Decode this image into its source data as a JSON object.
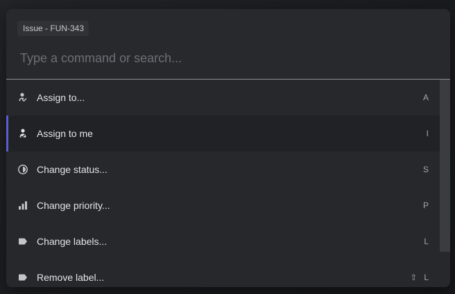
{
  "palette": {
    "context_chip": "Issue - FUN-343",
    "search": {
      "placeholder": "Type a command or search...",
      "value": ""
    },
    "commands": [
      {
        "label": "Assign to...",
        "icon": "person-assign-icon",
        "shortcut": [
          "A"
        ],
        "selected": false
      },
      {
        "label": "Assign to me",
        "icon": "person-assign-me-icon",
        "shortcut": [
          "I"
        ],
        "selected": true
      },
      {
        "label": "Change status...",
        "icon": "status-half-circle-icon",
        "shortcut": [
          "S"
        ],
        "selected": false
      },
      {
        "label": "Change priority...",
        "icon": "priority-bars-icon",
        "shortcut": [
          "P"
        ],
        "selected": false
      },
      {
        "label": "Change labels...",
        "icon": "label-tag-icon",
        "shortcut": [
          "L"
        ],
        "selected": false
      },
      {
        "label": "Remove label...",
        "icon": "label-tag-icon",
        "shortcut": [
          "⇧",
          "L"
        ],
        "selected": false
      }
    ],
    "scroll_fraction_visible": 0.83
  },
  "colors": {
    "panel": "#26282c",
    "selected_row": "#202226",
    "accent": "#5a5fd0",
    "text": "#e4e5e7",
    "muted": "#a3a6ab"
  }
}
